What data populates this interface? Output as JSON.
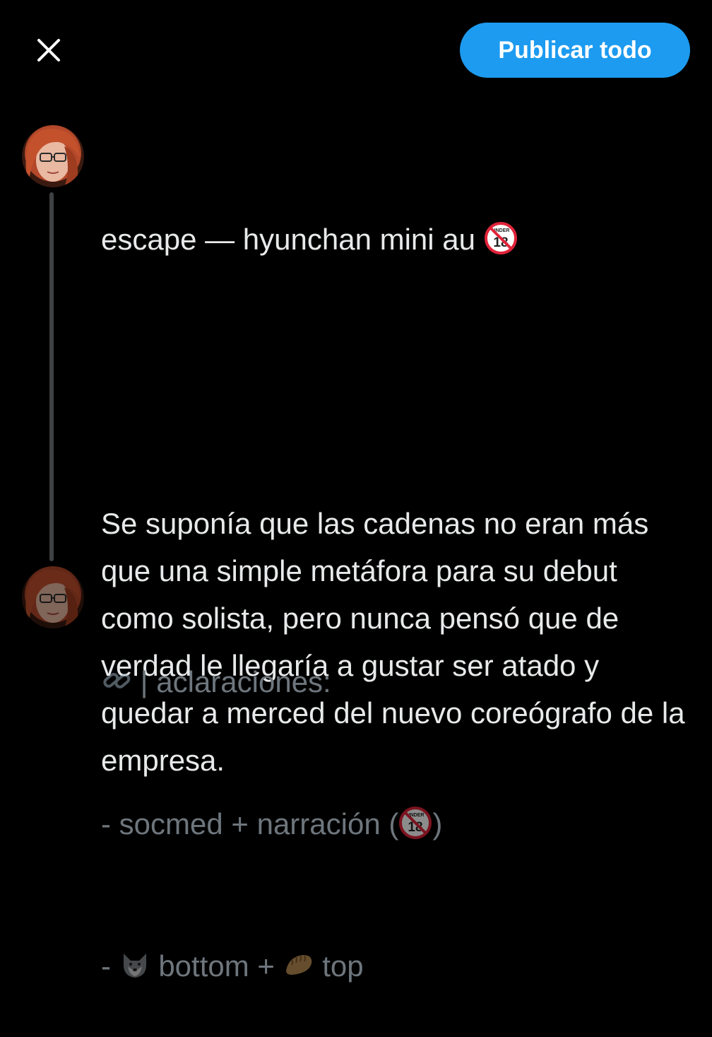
{
  "header": {
    "close_icon": "close-icon",
    "publish_label": "Publicar todo",
    "accent_color": "#1d9bf0"
  },
  "thread": [
    {
      "title_text": "escape — hyunchan mini au ",
      "title_badge_icon": "no-under-18-icon",
      "body": "Se suponía que las cadenas no eran más que una simple metáfora para su debut como solista, pero nunca pensó que de verdad le llegaría a gustar ser atado y quedar a merced del nuevo coreógrafo de la empresa."
    },
    {
      "line1_icon": "link-icon",
      "line1_text": " | aclaraciones:",
      "line2_prefix": "- socmed + narración (",
      "line2_icon": "no-under-18-icon",
      "line2_suffix": ")",
      "line3_prefix": "- ",
      "line3_icon_a": "wolf-icon",
      "line3_mid": " bottom + ",
      "line3_icon_b": "dumpling-icon",
      "line3_suffix": " top"
    }
  ]
}
